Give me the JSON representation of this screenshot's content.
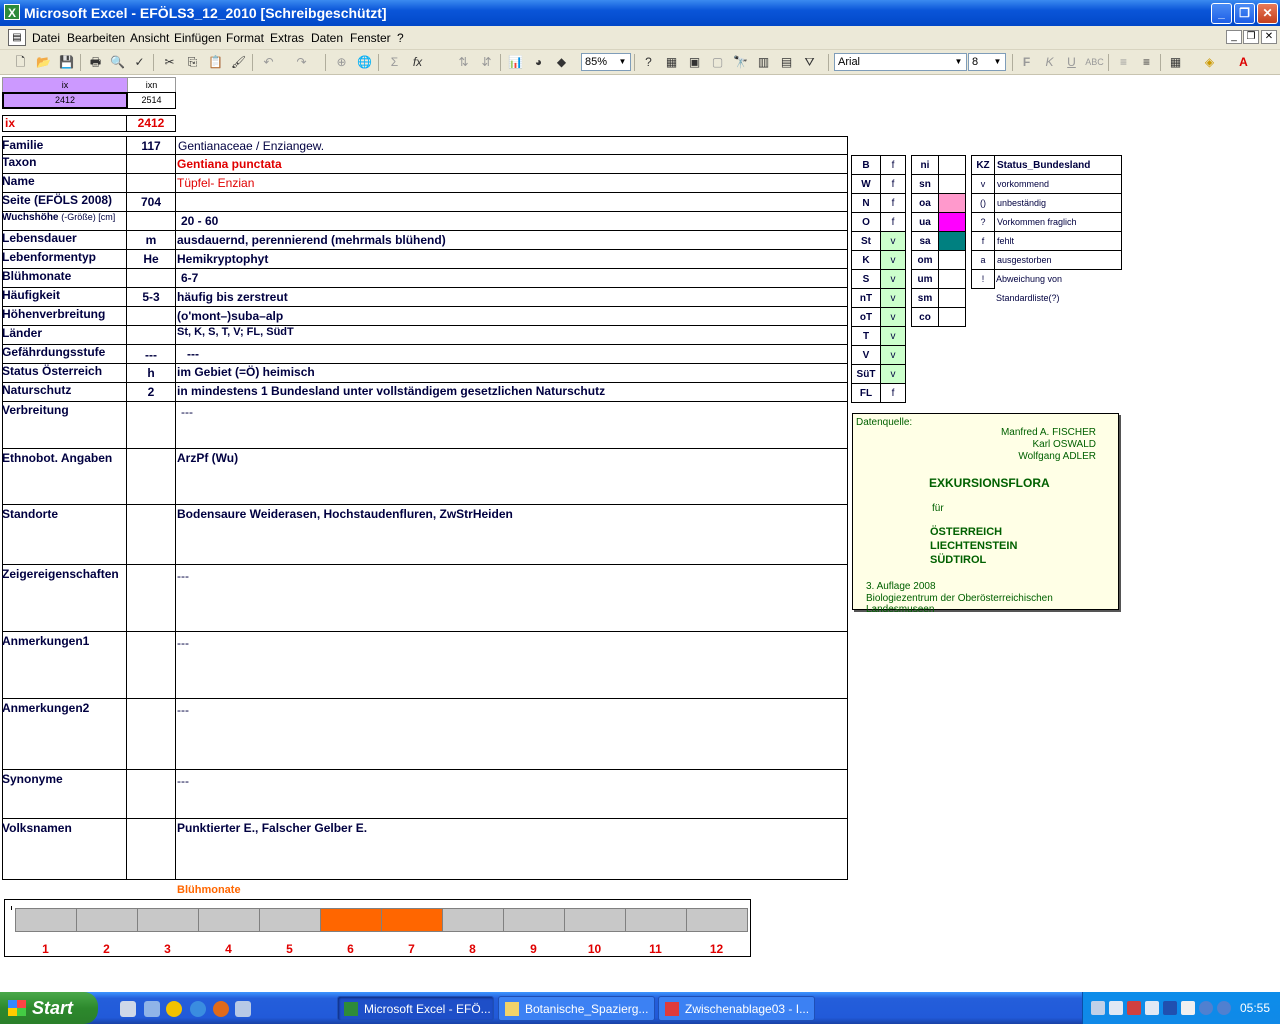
{
  "window": {
    "title": "Microsoft Excel - EFÖLS3_12_2010  [Schreibgeschützt]",
    "app_icon": "excel-icon"
  },
  "menu": {
    "items": [
      "Datei",
      "Bearbeiten",
      "Ansicht",
      "Einfügen",
      "Format",
      "Extras",
      "Daten",
      "Fenster",
      "?"
    ]
  },
  "toolbar": {
    "zoom": "85%",
    "font_name": "Arial",
    "font_size": "8"
  },
  "index": {
    "col1_header": "ix",
    "col2_header": "ixn",
    "col1_value": "2412",
    "col2_value": "2514",
    "ix_label": "ix",
    "ix_value": "2412"
  },
  "rows": {
    "familie": {
      "label": "Familie",
      "code": "117",
      "value": "Gentianaceae  /  Enziangew."
    },
    "taxon": {
      "label": "Taxon",
      "code": "",
      "value": "Gentiana punctata"
    },
    "name": {
      "label": "Name",
      "code": "",
      "value": "Tüpfel- Enzian"
    },
    "seite": {
      "label": "Seite (EFÖLS 2008)",
      "code": "704",
      "value": ""
    },
    "wuchshoehe": {
      "label": "Wuchshöhe",
      "label_suffix": "(-Größe) [cm]",
      "code": "",
      "value": "20 - 60"
    },
    "lebensdauer": {
      "label": "Lebensdauer",
      "code": "m",
      "value": "ausdauernd, perennierend (mehrmals blühend)"
    },
    "lebensform": {
      "label": "Lebenformentyp",
      "code": "He",
      "value": "Hemikryptophyt"
    },
    "bluehmonate": {
      "label": "Blühmonate",
      "code": "",
      "value": "6-7"
    },
    "haeufigkeit": {
      "label": "Häufigkeit",
      "code": "5-3",
      "value": "häufig bis zerstreut"
    },
    "hoehenverbreitung": {
      "label": "Höhenverbreitung",
      "code": "",
      "value": "(o'mont–)suba–alp"
    },
    "laender": {
      "label": "Länder",
      "code": "",
      "value": "St, K, S, T, V; FL, SüdT"
    },
    "gefaehrdung": {
      "label": "Gefährdungsstufe",
      "code": "---",
      "value": "---"
    },
    "status_oe": {
      "label": "Status Österreich",
      "code": "h",
      "value": "im Gebiet (=Ö) heimisch"
    },
    "naturschutz": {
      "label": "Naturschutz",
      "code": "2",
      "value": "in mindestens 1 Bundesland unter vollständigem gesetzlichen Naturschutz"
    },
    "verbreitung": {
      "label": "Verbreitung",
      "value": "---"
    },
    "ethnobot": {
      "label": "Ethnobot. Angaben",
      "value": "ArzPf (Wu)"
    },
    "standorte": {
      "label": "Standorte",
      "value": "Bodensaure Weiderasen, Hochstaudenfluren, ZwStrHeiden"
    },
    "zeiger": {
      "label": "Zeigereigenschaften",
      "value": "---"
    },
    "anm1": {
      "label": "Anmerkungen1",
      "value": "---"
    },
    "anm2": {
      "label": "Anmerkungen2",
      "value": "---"
    },
    "synonyme": {
      "label": "Synonyme",
      "value": "---"
    },
    "volksnamen": {
      "label": "Volksnamen",
      "value": "Punktierter E., Falscher Gelber E."
    }
  },
  "bundeslaender": [
    {
      "code": "B",
      "status": "f"
    },
    {
      "code": "W",
      "status": "f"
    },
    {
      "code": "N",
      "status": "f"
    },
    {
      "code": "O",
      "status": "f"
    },
    {
      "code": "St",
      "status": "v"
    },
    {
      "code": "K",
      "status": "v"
    },
    {
      "code": "S",
      "status": "v"
    },
    {
      "code": "nT",
      "status": "v"
    },
    {
      "code": "oT",
      "status": "v"
    },
    {
      "code": "T",
      "status": "v"
    },
    {
      "code": "V",
      "status": "v"
    },
    {
      "code": "SüT",
      "status": "v"
    },
    {
      "code": "FL",
      "status": "f"
    }
  ],
  "status_colors": {
    "v": "#ccffcc",
    "f": "#ffffff"
  },
  "areas": [
    {
      "code": "ni",
      "color": "#ffffff"
    },
    {
      "code": "sn",
      "color": "#ffffff"
    },
    {
      "code": "oa",
      "color": "#ff99cc"
    },
    {
      "code": "ua",
      "color": "#ff00ff"
    },
    {
      "code": "sa",
      "color": "#008080"
    },
    {
      "code": "om",
      "color": "#ffffff"
    },
    {
      "code": "um",
      "color": "#ffffff"
    },
    {
      "code": "sm",
      "color": "#ffffff"
    },
    {
      "code": "co",
      "color": "#ffffff"
    }
  ],
  "legend": {
    "header_kz": "KZ",
    "header_label": "Status_Bundesland",
    "items": [
      {
        "kz": "v",
        "text": "vorkommend"
      },
      {
        "kz": "()",
        "text": "unbeständig"
      },
      {
        "kz": "?",
        "text": "Vorkommen fraglich"
      },
      {
        "kz": "f",
        "text": "fehlt"
      },
      {
        "kz": "a",
        "text": "ausgestorben"
      },
      {
        "kz": "!",
        "text": "Abweichung von Standardliste(?)"
      }
    ]
  },
  "source": {
    "label": "Datenquelle:",
    "authors": [
      "Manfred A. FISCHER",
      "Karl OSWALD",
      "Wolfgang ADLER"
    ],
    "title": "EXKURSIONSFLORA",
    "fuer": "für",
    "regions": [
      "ÖSTERREICH",
      "LIECHTENSTEIN",
      "SÜDTIROL"
    ],
    "edition": "3. Auflage 2008",
    "publisher": "Biologiezentrum der Oberösterreichischen Landesmuseen"
  },
  "chart_data": {
    "type": "bar",
    "title": "Blühmonate",
    "categories": [
      "1",
      "2",
      "3",
      "4",
      "5",
      "6",
      "7",
      "8",
      "9",
      "10",
      "11",
      "12"
    ],
    "values": [
      0,
      0,
      0,
      0,
      0,
      1,
      1,
      0,
      0,
      0,
      0,
      0
    ],
    "colors": {
      "on": "#ff6600",
      "off": "#c8c8c8"
    }
  },
  "taskbar": {
    "start_label": "Start",
    "tasks": [
      {
        "label": "Microsoft Excel - EFÖ...",
        "icon": "excel-icon",
        "active": true
      },
      {
        "label": "Botanische_Spazierg...",
        "icon": "folder-icon",
        "active": false
      },
      {
        "label": "Zwischenablage03 - I...",
        "icon": "paint-icon",
        "active": false
      }
    ],
    "clock": "05:55"
  }
}
